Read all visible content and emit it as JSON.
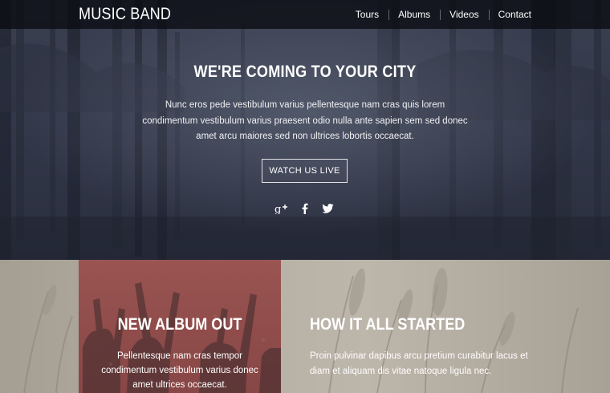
{
  "brand": "MUSIC BAND",
  "nav": {
    "items": [
      {
        "label": "Tours"
      },
      {
        "label": "Albums"
      },
      {
        "label": "Videos"
      },
      {
        "label": "Contact"
      }
    ]
  },
  "hero": {
    "title": "WE'RE COMING TO YOUR CITY",
    "text": "Nunc eros pede vestibulum varius pellentesque nam cras quis lorem condimentum vestibulum varius praesent odio nulla ante sapien sem sed donec amet arcu maiores sed non ultrices lobortis occaecat.",
    "cta_label": "WATCH US LIVE",
    "socials": [
      {
        "icon": "google-plus-icon"
      },
      {
        "icon": "facebook-icon"
      },
      {
        "icon": "twitter-icon"
      }
    ]
  },
  "album": {
    "title": "NEW ALBUM OUT",
    "text": "Pellentesque nam cras tempor condimentum vestibulum varius donec amet ultrices occaecat.",
    "panel_color": "#8f4c4a"
  },
  "story": {
    "title": "HOW IT ALL STARTED",
    "text": "Proin pulvinar dapibus arcu pretium curabitur lacus et diam et aliquam dis vitae natoque ligula nec."
  }
}
